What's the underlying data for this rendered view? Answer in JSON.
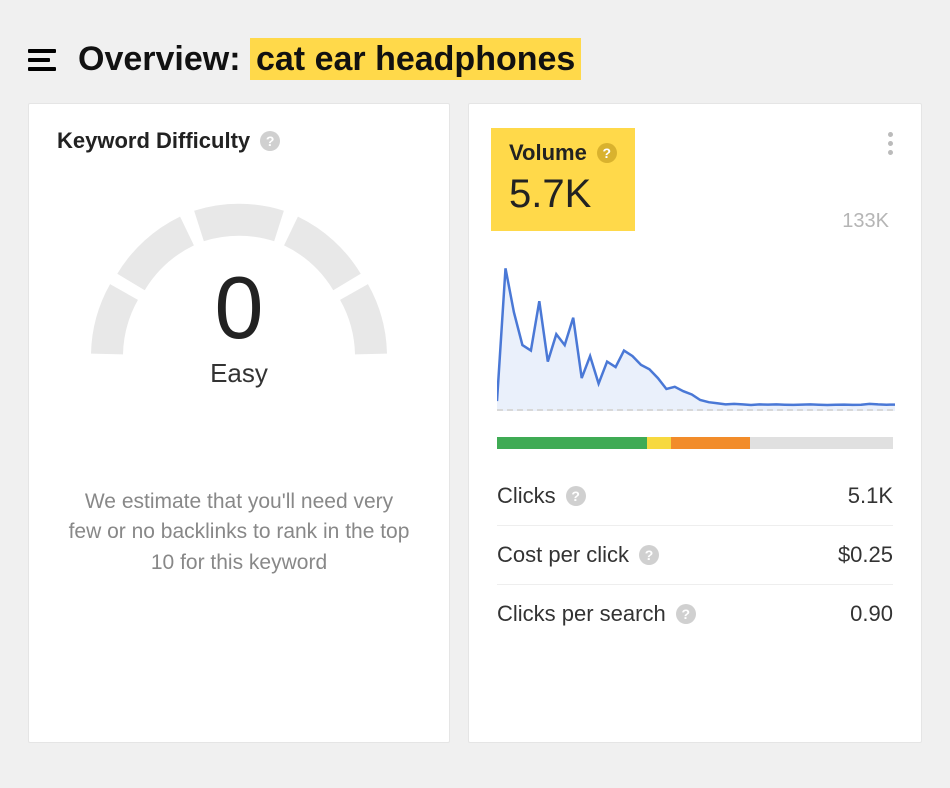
{
  "header": {
    "title_prefix": "Overview: ",
    "keyword": "cat ear headphones"
  },
  "difficulty_card": {
    "title": "Keyword Difficulty",
    "score": "0",
    "label": "Easy",
    "description": "We estimate that you'll need very few or no backlinks to rank in the top 10 for this keyword"
  },
  "volume_card": {
    "label": "Volume",
    "value": "5.7K",
    "peak": "133K",
    "diff_segments": [
      {
        "color": "#3fab54",
        "pct": 38
      },
      {
        "color": "#f7d93f",
        "pct": 6
      },
      {
        "color": "#f28c2a",
        "pct": 20
      },
      {
        "color": "#e0e0e0",
        "pct": 36
      }
    ],
    "stats": [
      {
        "label": "Clicks",
        "value": "5.1K",
        "help": true
      },
      {
        "label": "Cost per click",
        "value": "$0.25",
        "help": true
      },
      {
        "label": "Clicks per search",
        "value": "0.90",
        "help": true
      }
    ]
  },
  "chart_data": {
    "type": "area",
    "title": "Search volume trend",
    "ylim": [
      0,
      133000
    ],
    "baseline": 5700,
    "values": [
      9000,
      130000,
      90000,
      60000,
      55000,
      100000,
      45000,
      70000,
      60000,
      85000,
      30000,
      50000,
      25000,
      45000,
      40000,
      55000,
      50000,
      42000,
      38000,
      30000,
      20000,
      22000,
      18000,
      15000,
      10000,
      8000,
      7000,
      6000,
      6500,
      6000,
      5500,
      6000,
      5800,
      6000,
      5700,
      5600,
      5800,
      6000,
      5700,
      5500,
      5700,
      5800,
      5600,
      5700,
      6500,
      6000,
      5700,
      5800
    ]
  }
}
